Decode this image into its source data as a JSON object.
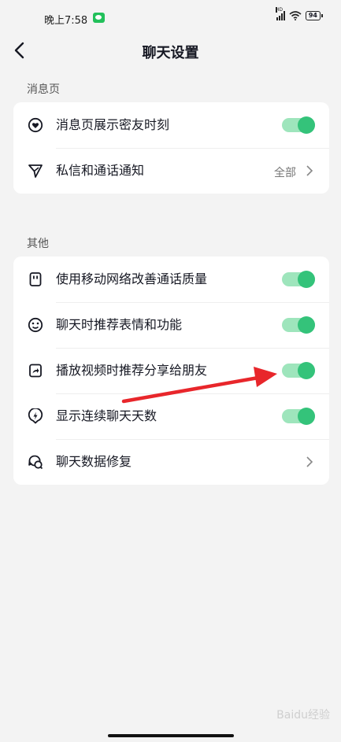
{
  "status_bar": {
    "time": "晚上7:58",
    "signal_label": "HD",
    "battery": "94"
  },
  "header": {
    "title": "聊天设置"
  },
  "sections": [
    {
      "label": "消息页",
      "items": [
        {
          "label": "消息页展示密友时刻",
          "icon": "heart-circle-icon",
          "toggle": true
        },
        {
          "label": "私信和通话通知",
          "icon": "send-icon",
          "value": "全部"
        }
      ]
    },
    {
      "label": "其他",
      "items": [
        {
          "label": "使用移动网络改善通话质量",
          "icon": "sim-card-icon",
          "toggle": true
        },
        {
          "label": "聊天时推荐表情和功能",
          "icon": "smiley-icon",
          "toggle": true
        },
        {
          "label": "播放视频时推荐分享给朋友",
          "icon": "share-icon",
          "toggle": true
        },
        {
          "label": "显示连续聊天天数",
          "icon": "lightning-icon",
          "toggle": true
        },
        {
          "label": "聊天数据修复",
          "icon": "chat-bubbles-icon"
        }
      ]
    }
  ],
  "watermark": "Baidu经验",
  "colors": {
    "toggle_on": "#34c37a",
    "toggle_track": "#9ee5bc",
    "arrow": "#e8262b"
  }
}
